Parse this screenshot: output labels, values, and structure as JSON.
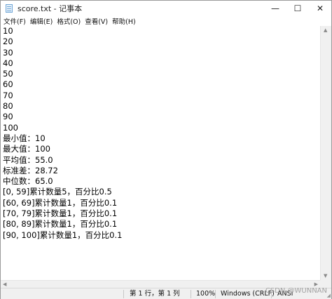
{
  "window": {
    "title": "score.txt - 记事本",
    "minimize_glyph": "—",
    "maximize_glyph": "☐",
    "close_glyph": "✕"
  },
  "menu": [
    "文件(F)",
    "编辑(E)",
    "格式(O)",
    "查看(V)",
    "帮助(H)"
  ],
  "document": {
    "lines": [
      "10",
      "20",
      "30",
      "40",
      "50",
      "60",
      "70",
      "80",
      "90",
      "100",
      "最小值：10",
      "最大值：100",
      "平均值：55.0",
      "标准差：28.72",
      "中位数：65.0",
      "[0, 59]累计数量5，百分比0.5",
      "[60, 69]累计数量1，百分比0.1",
      "[70, 79]累计数量1，百分比0.1",
      "[80, 89]累计数量1，百分比0.1",
      "[90, 100]累计数量1，百分比0.1"
    ]
  },
  "status": {
    "position": "第 1 行，第 1 列",
    "zoom": "100%",
    "line_ending": "Windows (CRLF)",
    "encoding": "ANSI"
  },
  "watermark": "CSDN @WUNNAN",
  "icons": {
    "app": "notepad-icon",
    "scroll_up": "▲",
    "scroll_down": "▼",
    "scroll_left": "◀",
    "scroll_right": "▶"
  }
}
